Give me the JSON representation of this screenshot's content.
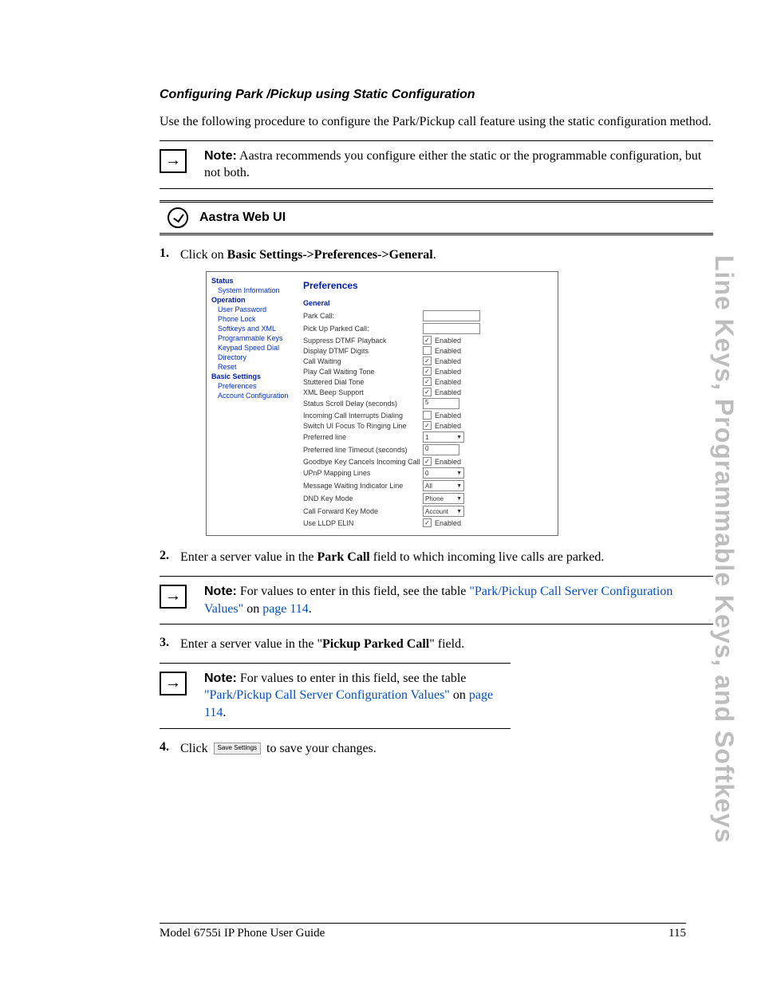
{
  "side_title": "Line Keys, Programmable Keys, and Softkeys",
  "heading": "Configuring Park /Pickup using Static Configuration",
  "intro": "Use the following procedure to configure the Park/Pickup call feature using the static configuration method.",
  "note1_bold": "Note:",
  "note1_text": " Aastra recommends you configure either the static or the programmable configuration, but not both.",
  "webui_label": "Aastra Web UI",
  "step1_num": "1.",
  "step1_a": "Click on ",
  "step1_b": "Basic Settings->Preferences->General",
  "step1_c": ".",
  "inset": {
    "nav_headers": {
      "status": "Status",
      "operation": "Operation",
      "basic": "Basic Settings"
    },
    "nav": {
      "status": [
        "System Information"
      ],
      "operation": [
        "User Password",
        "Phone Lock",
        "Softkeys and XML",
        "Programmable Keys",
        "Keypad Speed Dial",
        "Directory",
        "Reset"
      ],
      "basic": [
        "Preferences",
        "Account Configuration"
      ]
    },
    "title": "Preferences",
    "sub": "General",
    "rows": [
      {
        "label": "Park Call:",
        "type": "text",
        "value": ""
      },
      {
        "label": "Pick Up Parked Call:",
        "type": "text",
        "value": ""
      },
      {
        "label": "Suppress DTMF Playback",
        "type": "check",
        "checked": true,
        "text": "Enabled"
      },
      {
        "label": "Display DTMF Digits",
        "type": "check",
        "checked": false,
        "text": "Enabled"
      },
      {
        "label": "Call Waiting",
        "type": "check",
        "checked": true,
        "text": "Enabled"
      },
      {
        "label": "Play Call Waiting Tone",
        "type": "check",
        "checked": true,
        "text": "Enabled"
      },
      {
        "label": "Stuttered Dial Tone",
        "type": "check",
        "checked": true,
        "text": "Enabled"
      },
      {
        "label": "XML Beep Support",
        "type": "check",
        "checked": true,
        "text": "Enabled"
      },
      {
        "label": "Status Scroll Delay (seconds)",
        "type": "textsm",
        "value": "5"
      },
      {
        "label": "Incoming Call Interrupts Dialing",
        "type": "check",
        "checked": false,
        "text": "Enabled"
      },
      {
        "label": "Switch UI Focus To Ringing Line",
        "type": "check",
        "checked": true,
        "text": "Enabled"
      },
      {
        "label": "Preferred line",
        "type": "select",
        "value": "1"
      },
      {
        "label": "Preferred line Timeout (seconds)",
        "type": "textsm",
        "value": "0"
      },
      {
        "label": "Goodbye Key Cancels Incoming Call",
        "type": "check",
        "checked": true,
        "text": "Enabled"
      },
      {
        "label": "UPnP Mapping Lines",
        "type": "select",
        "value": "0"
      },
      {
        "label": "Message Waiting Indicator Line",
        "type": "select",
        "value": "All"
      },
      {
        "label": "DND Key Mode",
        "type": "select",
        "value": "Phone"
      },
      {
        "label": "Call Forward Key Mode",
        "type": "select",
        "value": "Account"
      },
      {
        "label": "Use LLDP ELIN",
        "type": "check",
        "checked": true,
        "text": "Enabled"
      }
    ]
  },
  "step2_num": "2.",
  "step2_a": "Enter a server value in the ",
  "step2_b": "Park Call",
  "step2_c": " field to which incoming live calls are parked.",
  "note2_bold": "Note:",
  "note2_text_a": " For values to enter in this field, see the table ",
  "note2_link": "\"Park/Pickup Call Server Configuration Values\"",
  "note2_on": " on ",
  "note2_page": "page 114",
  "note2_dot": ".",
  "step3_num": "3.",
  "step3_a": "Enter a server value in the \"",
  "step3_b": "Pickup Parked Call",
  "step3_c": "\" field.",
  "note3_bold": "Note:",
  "note3_text_a": " For values to enter in this field, see the table ",
  "note3_link": "\"Park/Pickup Call Server Configuration Values\"",
  "note3_on": " on ",
  "note3_page": "page 114",
  "note3_dot": ".",
  "step4_num": "4.",
  "step4_a": "Click ",
  "step4_btn": "Save Settings",
  "step4_b": " to save your changes.",
  "footer_left": "Model 6755i IP Phone User Guide",
  "footer_right": "115"
}
